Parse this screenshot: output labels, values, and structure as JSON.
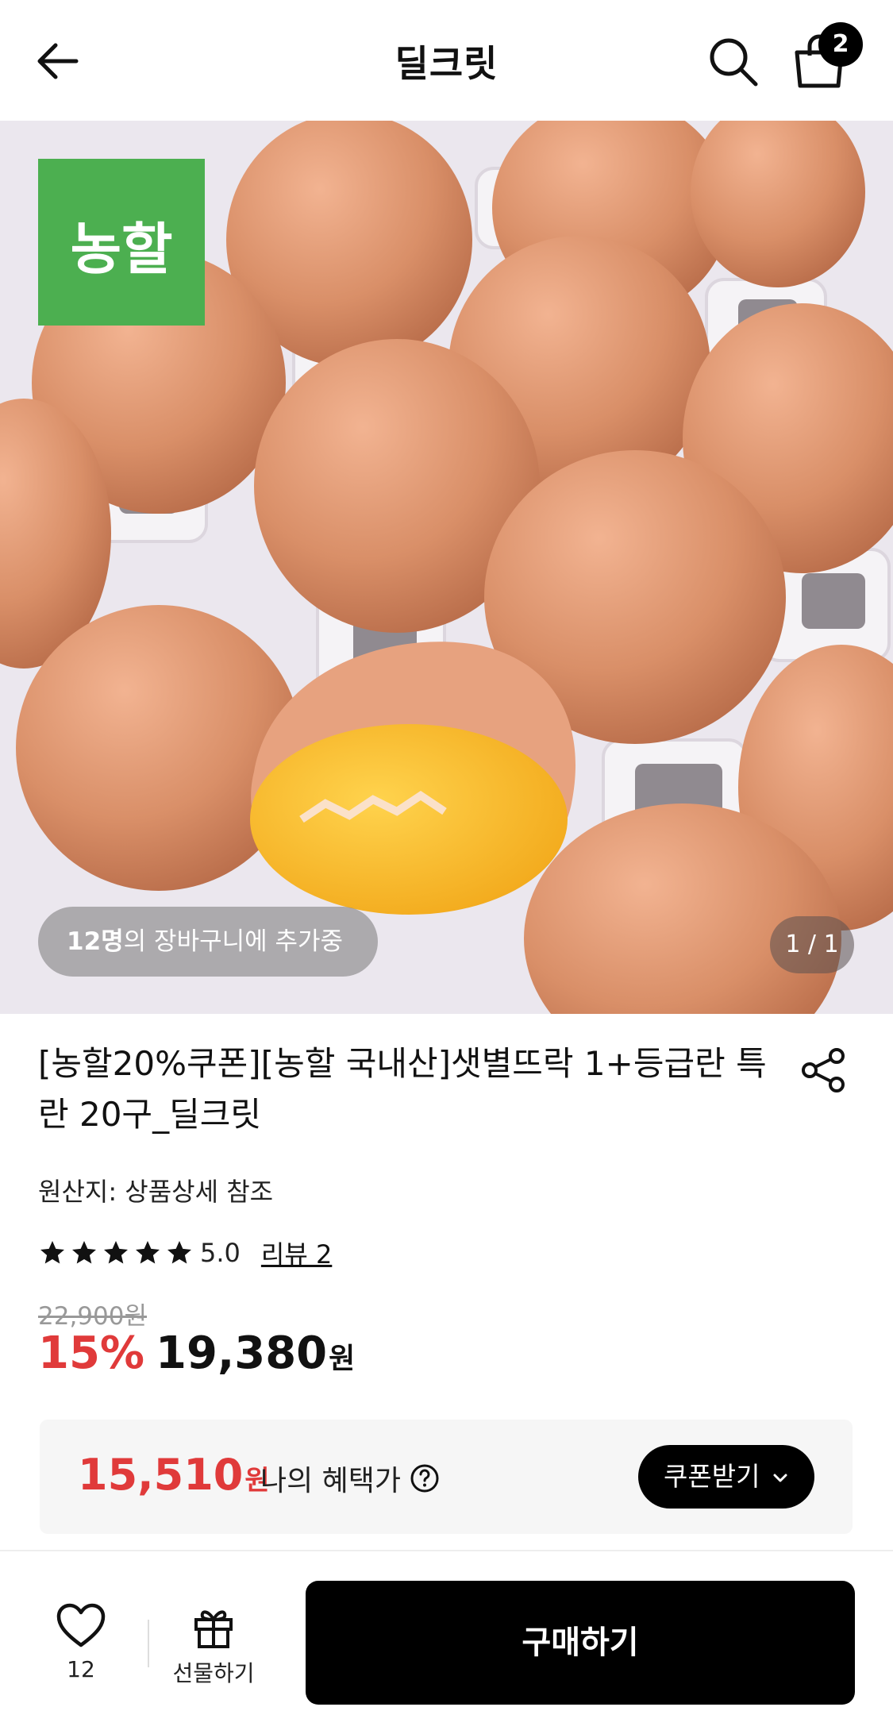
{
  "header": {
    "title": "딜크릿",
    "cart_count": "2",
    "icons": [
      "arrow-left-icon",
      "search-icon",
      "shopping-bag-icon"
    ]
  },
  "hero": {
    "brand_logo_text": "농할",
    "cart_count_bold": "12명",
    "cart_text": "의 장바구니에 추가중",
    "page_indicator": "1 / 1"
  },
  "product": {
    "title": "[농할20%쿠폰][농할 국내산]샛별뜨락 1+등급란 특란 20구_딜크릿",
    "origin": "원산지: 상품상세 참조",
    "rating_stars": 5,
    "rating_score": "5.0",
    "review_label": "리뷰 2",
    "original_price": "22,900원",
    "discount": "15%",
    "price": "19,380",
    "price_unit": "원"
  },
  "benefit": {
    "price": "15,510",
    "price_unit": "원",
    "label": "나의 혜택가",
    "coupon_button": "쿠폰받기"
  },
  "bottom_bar": {
    "wish_count": "12",
    "gift_label": "선물하기",
    "buy_label": "구매하기"
  },
  "colors": {
    "accent_red": "#e03a3a",
    "brand_green": "#4caf50",
    "button_black": "#000000"
  }
}
